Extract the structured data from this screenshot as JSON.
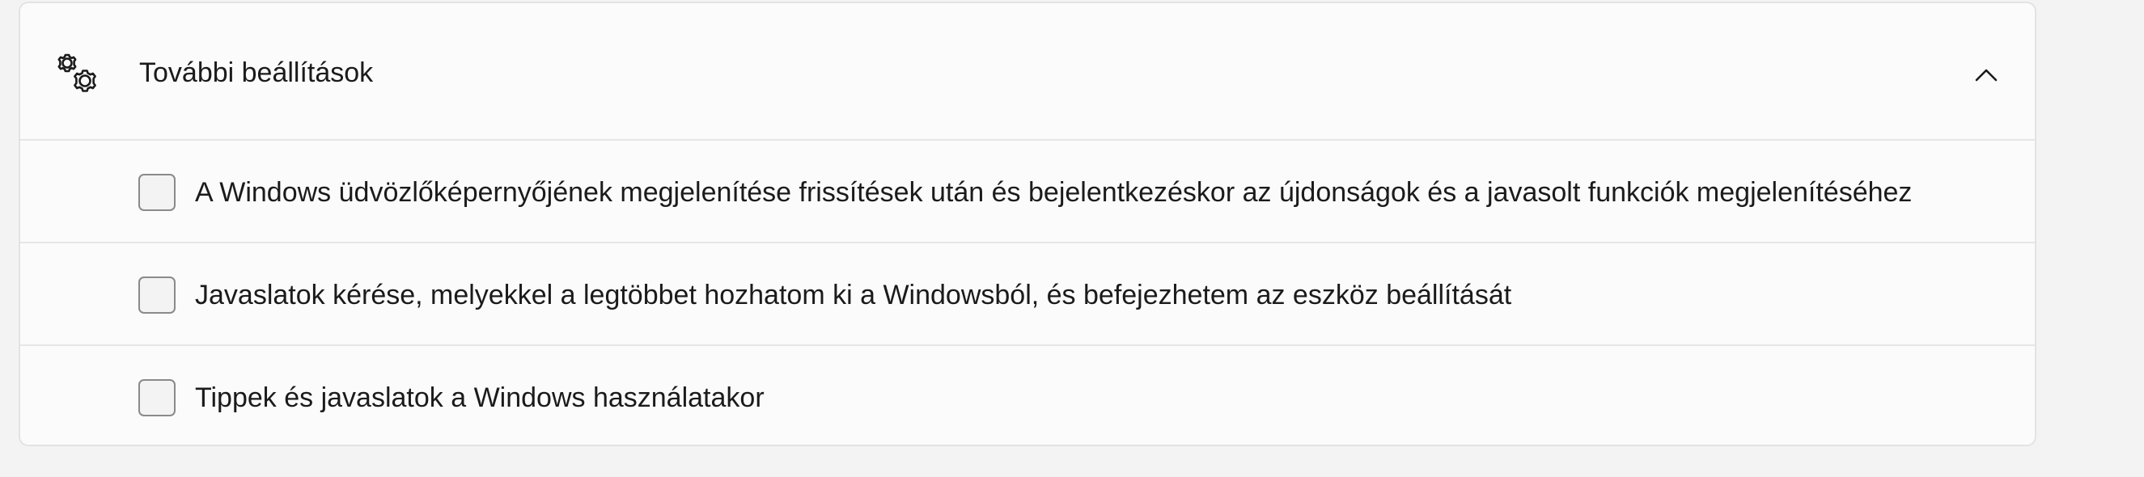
{
  "section": {
    "title": "További beállítások",
    "icon": "gears-icon",
    "expanded": true,
    "toggle_icon": "chevron-up-icon"
  },
  "options": [
    {
      "label": "A Windows üdvözlőképernyőjének megjelenítése frissítések után és bejelentkezéskor az újdonságok és a javasolt funkciók megjelenítéséhez",
      "checked": false
    },
    {
      "label": "Javaslatok kérése, melyekkel a legtöbbet hozhatom ki a Windowsból, és befejezhetem az eszköz beállítását",
      "checked": false
    },
    {
      "label": "Tippek és javaslatok a Windows használatakor",
      "checked": false
    }
  ]
}
